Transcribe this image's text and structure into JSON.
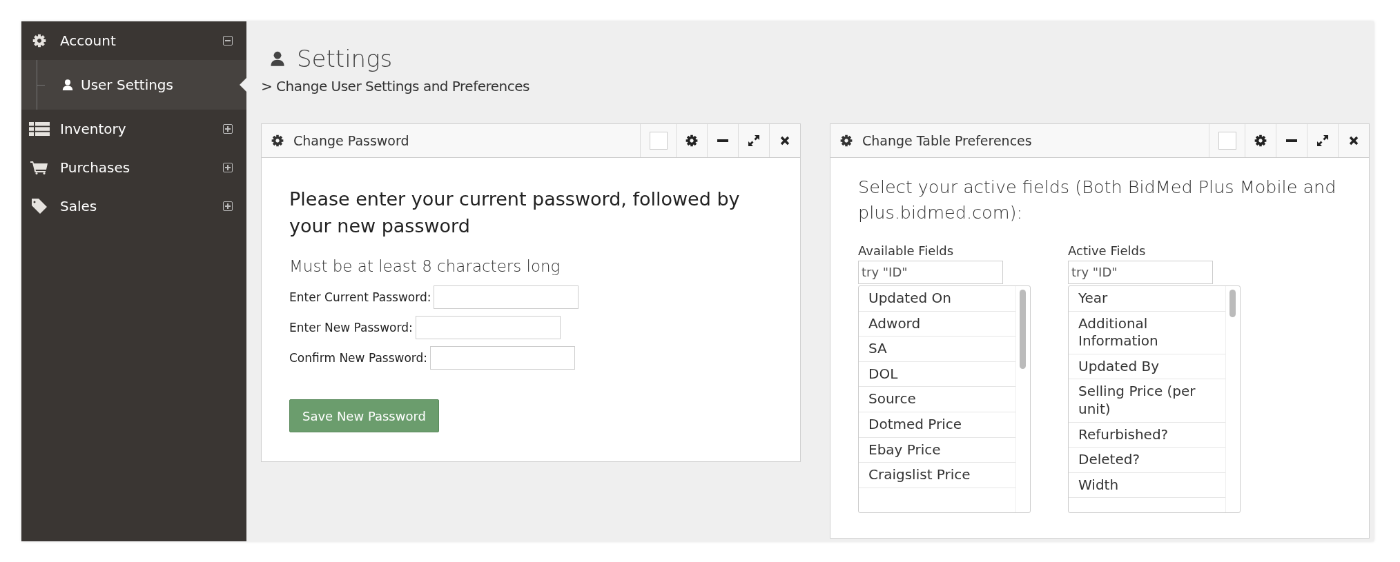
{
  "sidebar": {
    "items": [
      {
        "label": "Account",
        "expanded": true,
        "children": [
          {
            "label": "User Settings",
            "selected": true
          }
        ]
      },
      {
        "label": "Inventory",
        "expanded": false
      },
      {
        "label": "Purchases",
        "expanded": false
      },
      {
        "label": "Sales",
        "expanded": false
      }
    ]
  },
  "header": {
    "title": "Settings",
    "breadcrumb": "> Change User Settings and Preferences"
  },
  "password_panel": {
    "title": "Change Password",
    "heading": "Please enter your current password, followed by your new password",
    "hint": "Must be at least 8 characters long",
    "fields": [
      {
        "label": "Enter Current Password:"
      },
      {
        "label": "Enter New Password:"
      },
      {
        "label": "Confirm New Password:"
      }
    ],
    "button": "Save New Password"
  },
  "table_panel": {
    "title": "Change Table Preferences",
    "intro": "Select your active fields (Both BidMed Plus Mobile and plus.bidmed.com):",
    "lists": [
      {
        "label": "Available Fields",
        "placeholder": "try \"ID\"",
        "items": [
          "Updated On",
          "Adword",
          "SA",
          "DOL",
          "Source",
          "Dotmed Price",
          "Ebay Price",
          "Craigslist Price"
        ]
      },
      {
        "label": "Active Fields",
        "placeholder": "try \"ID\"",
        "items": [
          "Year",
          "Additional Information",
          "Updated By",
          "Selling Price (per unit)",
          "Refurbished?",
          "Deleted?",
          "Width"
        ]
      }
    ]
  }
}
